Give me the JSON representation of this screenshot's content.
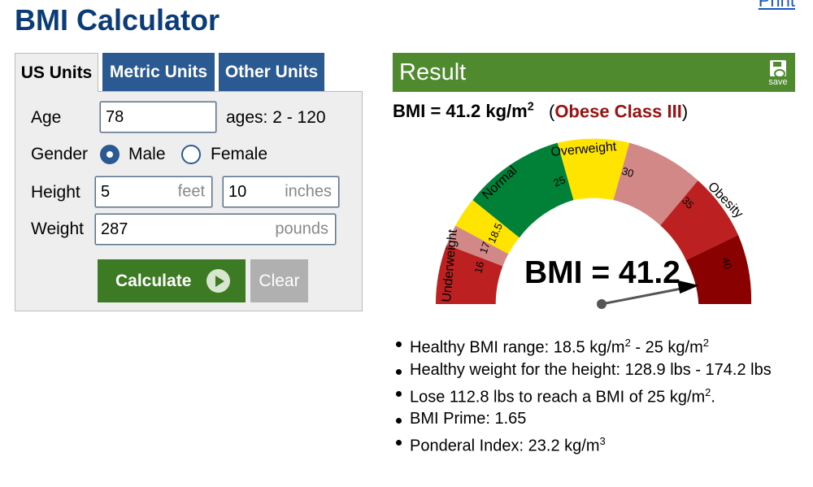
{
  "page": {
    "title": "BMI Calculator",
    "print_label": "Print"
  },
  "tabs": [
    {
      "label": "US Units",
      "active": true
    },
    {
      "label": "Metric Units",
      "active": false
    },
    {
      "label": "Other Units",
      "active": false
    }
  ],
  "form": {
    "age": {
      "label": "Age",
      "value": "78",
      "hint": "ages: 2 - 120"
    },
    "gender": {
      "label": "Gender",
      "selected": "Male",
      "options": [
        "Male",
        "Female"
      ]
    },
    "height": {
      "label": "Height",
      "feet_value": "5",
      "feet_unit": "feet",
      "inches_value": "10",
      "inches_unit": "inches"
    },
    "weight": {
      "label": "Weight",
      "value": "287",
      "unit": "pounds"
    },
    "calculate_label": "Calculate",
    "clear_label": "Clear"
  },
  "result": {
    "header": "Result",
    "save_label": "save",
    "bmi_prefix": "BMI = 41.2 kg/m",
    "bmi_exp": "2",
    "classification": "Obese Class III",
    "gauge": {
      "display_text": "BMI = 41.2",
      "bmi_value": 41.2,
      "zone_labels": [
        "Underweight",
        "Normal",
        "Overweight",
        "Obesity"
      ],
      "tick_labels": [
        "16",
        "17",
        "18.5",
        "25",
        "30",
        "35",
        "40"
      ],
      "colors": {
        "red": "#bc2020",
        "yellow": "#ffe400",
        "green": "#008137",
        "pink": "#d38888",
        "dark_red": "#8a0101"
      }
    },
    "details": {
      "healthy_range": {
        "prefix": "Healthy BMI range: 18.5 kg/m",
        "exp1": "2",
        "middle": " - 25 kg/m",
        "exp2": "2"
      },
      "healthy_weight": "Healthy weight for the height: 128.9 lbs - 174.2 lbs",
      "lose": {
        "prefix": "Lose 112.8 lbs to reach a BMI of 25 kg/m",
        "exp": "2",
        "suffix": "."
      },
      "prime": "BMI Prime: 1.65",
      "ponderal": {
        "prefix": "Ponderal Index: 23.2 kg/m",
        "exp": "3"
      }
    }
  }
}
